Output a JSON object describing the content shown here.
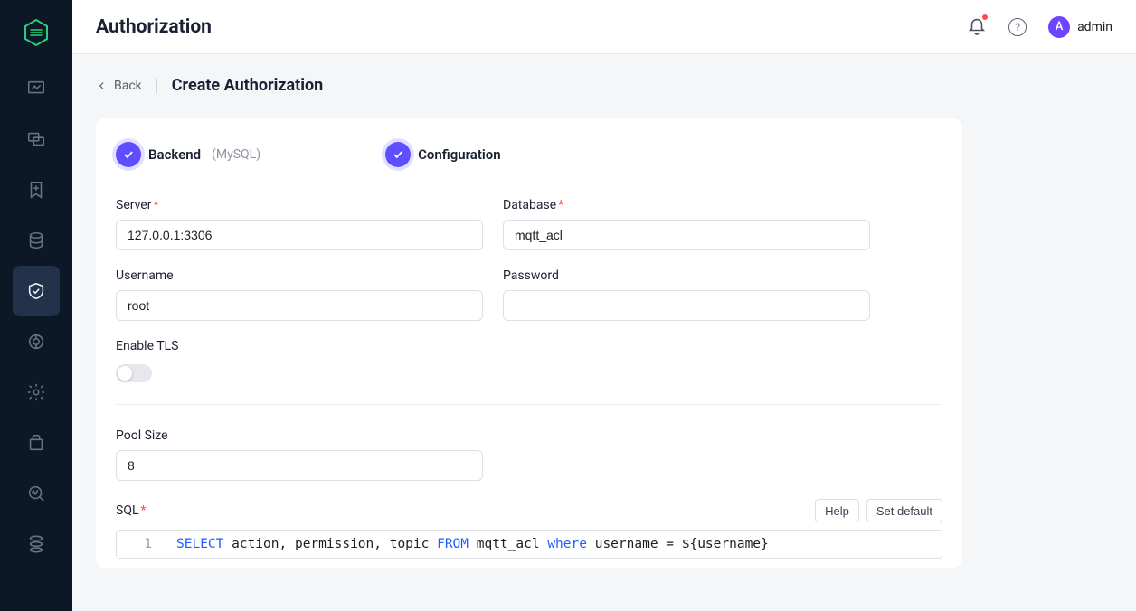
{
  "header": {
    "title": "Authorization",
    "user_initial": "A",
    "user_name": "admin",
    "help_char": "?"
  },
  "page": {
    "back_label": "Back",
    "heading": "Create Authorization"
  },
  "steps": {
    "s1_label": "Backend",
    "s1_sub": "(MySQL)",
    "s2_label": "Configuration"
  },
  "form": {
    "server_label": "Server",
    "server_value": "127.0.0.1:3306",
    "database_label": "Database",
    "database_value": "mqtt_acl",
    "username_label": "Username",
    "username_value": "root",
    "password_label": "Password",
    "password_value": "",
    "tls_label": "Enable TLS",
    "pool_label": "Pool Size",
    "pool_value": "8",
    "sql_label": "SQL",
    "help_btn": "Help",
    "default_btn": "Set default",
    "sql_line_no": "1",
    "sql_tokens": {
      "k1": "SELECT",
      "t1": " action, permission, topic ",
      "k2": "FROM",
      "t2": " mqtt_acl ",
      "k3": "where",
      "t3": " username = ${username}"
    }
  }
}
